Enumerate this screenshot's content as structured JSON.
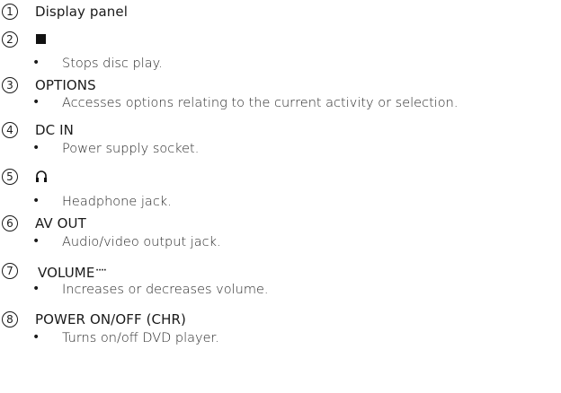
{
  "items": [
    {
      "number": "1",
      "title": "Display panel"
    },
    {
      "number": "2",
      "icon": "stop-square-icon",
      "desc": "Stops disc play."
    },
    {
      "number": "3",
      "title": "OPTIONS",
      "desc": "Accesses options relating to the current activity or selection."
    },
    {
      "number": "4",
      "title": "DC IN",
      "desc": "Power supply socket."
    },
    {
      "number": "5",
      "icon": "headphone-icon",
      "desc": "Headphone jack."
    },
    {
      "number": "6",
      "title": "AV OUT",
      "desc": "Audio/video output jack."
    },
    {
      "number": "7",
      "title": "VOLUME",
      "title_suffix": "····",
      "desc": "Increases or decreases volume."
    },
    {
      "number": "8",
      "title": "POWER ON/OFF (CHR)",
      "desc": "Turns on/off DVD player."
    }
  ],
  "bullet": "•"
}
